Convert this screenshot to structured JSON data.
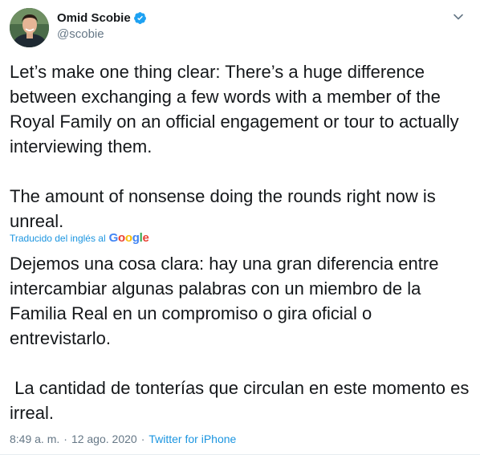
{
  "author": {
    "display_name": "Omid Scobie",
    "handle": "@scobie",
    "verified": true,
    "avatar_icon": "profile-photo"
  },
  "tweet": {
    "original_text": "Let’s make one thing clear: There’s a huge difference between exchanging a few words with a member of the Royal Family on an official engagement or tour to actually interviewing them.\n\nThe amount of nonsense doing the rounds right now is unreal.",
    "translated_by_label": "Traducido del inglés al",
    "translator_name": "Google",
    "translated_text": "Dejemos una cosa clara: hay una gran diferencia entre intercambiar algunas palabras con un miembro de la Familia Real en un compromiso o gira oficial o entrevistarlo.\n\n La cantidad de tonterías que circulan en este momento es irreal."
  },
  "meta": {
    "time": "8:49 a. m.",
    "separator": "·",
    "date": "12 ago. 2020",
    "source": "Twitter for iPhone"
  },
  "colors": {
    "link": "#1b95e0",
    "verified": "#1da1f2",
    "secondary_text": "#657786",
    "primary_text": "#14171a"
  },
  "icons": {
    "verified": "verified-badge-icon",
    "menu": "chevron-down-icon"
  }
}
